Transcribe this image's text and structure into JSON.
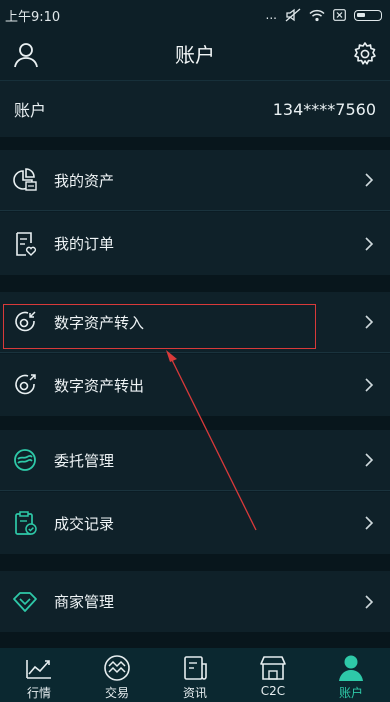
{
  "status_bar": {
    "time": "上午9:10",
    "dots": "..."
  },
  "header": {
    "title": "账户"
  },
  "account": {
    "label": "账户",
    "value": "134****7560"
  },
  "menu": [
    {
      "label": "我的资产",
      "icon": "pie-chart-icon"
    },
    {
      "label": "我的订单",
      "icon": "order-list-icon"
    },
    {
      "label": "数字资产转入",
      "icon": "transfer-in-icon"
    },
    {
      "label": "数字资产转出",
      "icon": "transfer-out-icon"
    },
    {
      "label": "委托管理",
      "icon": "delegate-icon"
    },
    {
      "label": "成交记录",
      "icon": "clipboard-check-icon"
    },
    {
      "label": "商家管理",
      "icon": "diamond-icon"
    }
  ],
  "tabs": [
    {
      "label": "行情",
      "icon": "chart-icon"
    },
    {
      "label": "交易",
      "icon": "trade-icon"
    },
    {
      "label": "资讯",
      "icon": "news-icon"
    },
    {
      "label": "C2C",
      "icon": "shop-icon"
    },
    {
      "label": "账户",
      "icon": "user-icon",
      "active": true
    }
  ],
  "colors": {
    "accent": "#2ec9a8",
    "highlight": "#d83a3a",
    "background": "#0b1c24"
  }
}
